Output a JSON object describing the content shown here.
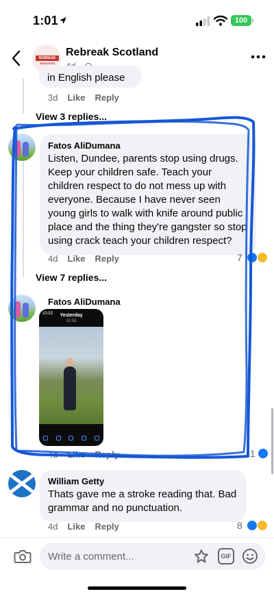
{
  "status_bar": {
    "time": "1:01",
    "battery": "100"
  },
  "header": {
    "page_name": "Rebreak Scotland",
    "meta": "4d ·",
    "avatar_logo_text": "REBREAK NEWS"
  },
  "top_comment": {
    "partial_text": "in English please",
    "time": "3d",
    "like": "Like",
    "reply": "Reply"
  },
  "view_replies_1": "View 3 replies...",
  "comment_1": {
    "author": "Fatos AliDumana",
    "text": "Listen, Dundee, parents stop using drugs. Keep your children safe. Teach your children respect to do not mess up with everyone. Because I have never seen young girls to walk with knife around public place and the thing they're gangster so stop using crack teach your children respect?",
    "time": "4d",
    "like": "Like",
    "reply": "Reply",
    "reactions": "7"
  },
  "view_replies_2": "View 7 replies...",
  "comment_2": {
    "author": "Fatos AliDumana",
    "attachment_header": "Yesterday",
    "attachment_time": "10:55",
    "status_time": "10:53",
    "time": "4d",
    "like": "Like",
    "reply": "Reply",
    "reactions": "1"
  },
  "comment_3": {
    "author": "William Getty",
    "text": "Thats gave me a stroke reading that. Bad grammar and no punctuation.",
    "time": "4d",
    "like": "Like",
    "reply": "Reply",
    "reactions": "8"
  },
  "composer": {
    "placeholder": "Write a comment...",
    "gif": "GIF"
  },
  "colors": {
    "accent": "#1877f2",
    "scribble": "#1557d6",
    "bubble": "#f0f2f5",
    "meta": "#65676b"
  }
}
